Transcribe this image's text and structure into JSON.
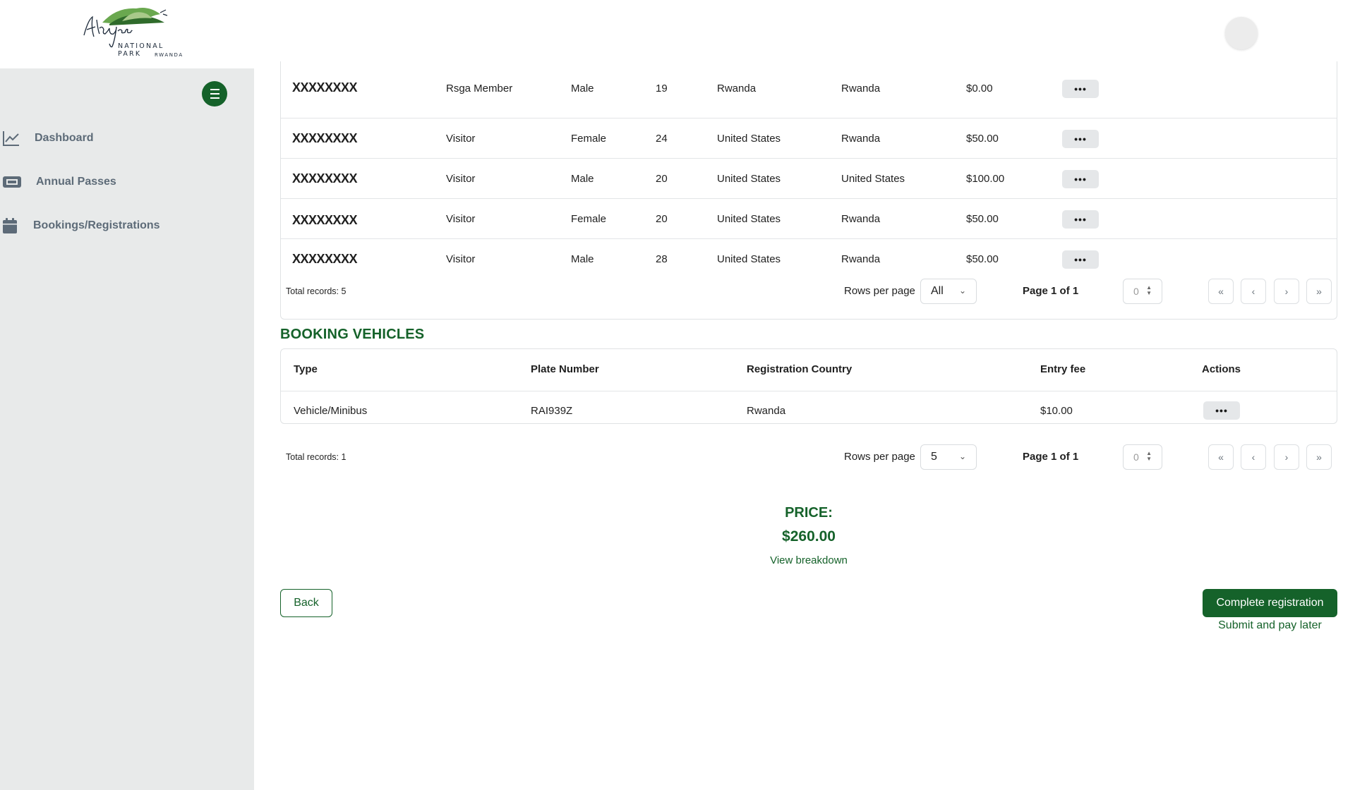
{
  "header": {
    "logo_script": "Akagera",
    "logo_line1": "NATIONAL PARK",
    "logo_line2": "RWANDA"
  },
  "sidebar": {
    "items": [
      {
        "label": "Dashboard",
        "icon": "chart-line-icon"
      },
      {
        "label": "Annual Passes",
        "icon": "ticket-icon"
      },
      {
        "label": "Bookings/Registrations",
        "icon": "calendar-icon"
      }
    ]
  },
  "visitors": {
    "rows": [
      {
        "name": "XXXXXXXX",
        "type": "Rsga Member",
        "gender": "Male",
        "age": "19",
        "nationality": "Rwanda",
        "residence": "Rwanda",
        "fee": "$0.00",
        "action": "•••"
      },
      {
        "name": "XXXXXXXX",
        "type": "Visitor",
        "gender": "Female",
        "age": "24",
        "nationality": "United States",
        "residence": "Rwanda",
        "fee": "$50.00",
        "action": "•••"
      },
      {
        "name": "XXXXXXXX",
        "type": "Visitor",
        "gender": "Male",
        "age": "20",
        "nationality": "United States",
        "residence": "United States",
        "fee": "$100.00",
        "action": "•••"
      },
      {
        "name": "XXXXXXXX",
        "type": "Visitor",
        "gender": "Female",
        "age": "20",
        "nationality": "United States",
        "residence": "Rwanda",
        "fee": "$50.00",
        "action": "•••"
      },
      {
        "name": "XXXXXXXX",
        "type": "Visitor",
        "gender": "Male",
        "age": "28",
        "nationality": "United States",
        "residence": "Rwanda",
        "fee": "$50.00",
        "action": "•••"
      }
    ],
    "pager": {
      "total": "Total records: 5",
      "rows_per_page_label": "Rows per page",
      "rows_per_page_value": "All",
      "page_of": "Page 1 of 1",
      "page_input": "0"
    }
  },
  "vehicles": {
    "title": "BOOKING VEHICLES",
    "headers": {
      "type": "Type",
      "plate": "Plate Number",
      "country": "Registration Country",
      "fee": "Entry fee",
      "actions": "Actions"
    },
    "rows": [
      {
        "type": "Vehicle/Minibus",
        "plate": "RAI939Z",
        "country": "Rwanda",
        "fee": "$10.00",
        "action": "•••"
      }
    ],
    "pager": {
      "total": "Total records: 1",
      "rows_per_page_label": "Rows per page",
      "rows_per_page_value": "5",
      "page_of": "Page 1 of 1",
      "page_input": "0"
    }
  },
  "summary": {
    "price_label": "PRICE:",
    "price_value": "$260.00",
    "view_breakdown": "View breakdown"
  },
  "actions": {
    "back": "Back",
    "complete": "Complete registration",
    "later": "Submit and pay later"
  },
  "colors": {
    "brand_green": "#15622a",
    "sidebar_bg": "#e8eaea"
  }
}
